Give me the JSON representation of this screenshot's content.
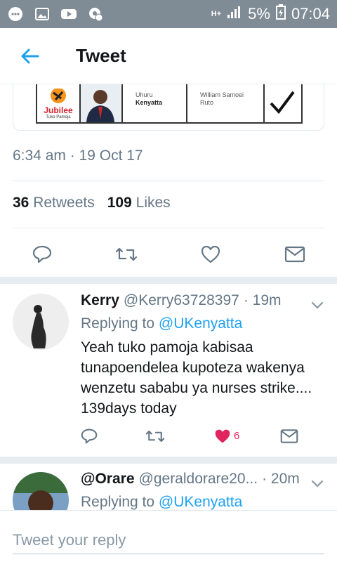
{
  "status_bar": {
    "network": "H+",
    "battery": "5%",
    "time": "07:04",
    "icons": [
      "messenger-icon",
      "gallery-icon",
      "youtube-icon",
      "settings-badge-icon"
    ]
  },
  "app_bar": {
    "title": "Tweet",
    "back_icon": "arrow-left-icon"
  },
  "ballot": {
    "party": "Jubilee",
    "party_sub": "Tuko Pamoja",
    "candidate_first": "Uhuru",
    "candidate_last": "Kenyatta",
    "running_first": "William Samoei",
    "running_last": "Ruto"
  },
  "tweet": {
    "timestamp": "6:34 am · 19 Oct 17",
    "retweets_count": "36",
    "retweets_label": "Retweets",
    "likes_count": "109",
    "likes_label": "Likes"
  },
  "replies": [
    {
      "name": "Kerry",
      "handle": "@Kerry63728397",
      "time": "· 19m",
      "replying_prefix": "Replying to",
      "replying_to": "@UKenyatta",
      "text": "Yeah tuko pamoja kabisaa tunapoendelea kupoteza wakenya wenzetu sababu ya nurses strike.... 139days today",
      "like_count": "6"
    },
    {
      "name": "@Orare",
      "handle": "@geraldorare20...",
      "time": "· 20m",
      "replying_prefix": "Replying to",
      "replying_to": "@UKenyatta"
    }
  ],
  "composer": {
    "placeholder": "Tweet your reply"
  },
  "colors": {
    "accent": "#1da1f2",
    "like": "#e0245e",
    "muted": "#657786",
    "status_bar": "#7f8b95"
  }
}
